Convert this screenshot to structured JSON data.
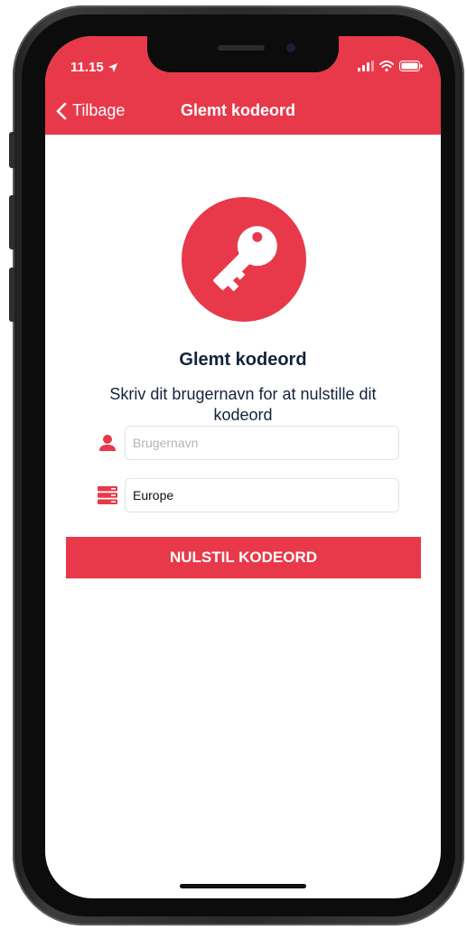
{
  "status_bar": {
    "time": "11.15"
  },
  "nav": {
    "back_label": "Tilbage",
    "title": "Glemt kodeord"
  },
  "content": {
    "heading": "Glemt kodeord",
    "description": "Skriv dit brugernavn for at nulstille dit kodeord"
  },
  "form": {
    "username": {
      "value": "",
      "placeholder": "Brugernavn"
    },
    "server": {
      "selected": "Europe"
    },
    "submit_label": "NULSTIL KODEORD"
  },
  "colors": {
    "accent": "#e8394a",
    "heading_text": "#14223c",
    "input_border": "#e4e4e4"
  },
  "icons": {
    "back": "chevron-left-icon",
    "key": "key-icon",
    "user": "user-icon",
    "server": "server-icon",
    "location_arrow": "location-arrow-icon",
    "signal": "signal-icon",
    "wifi": "wifi-icon",
    "battery": "battery-icon"
  }
}
